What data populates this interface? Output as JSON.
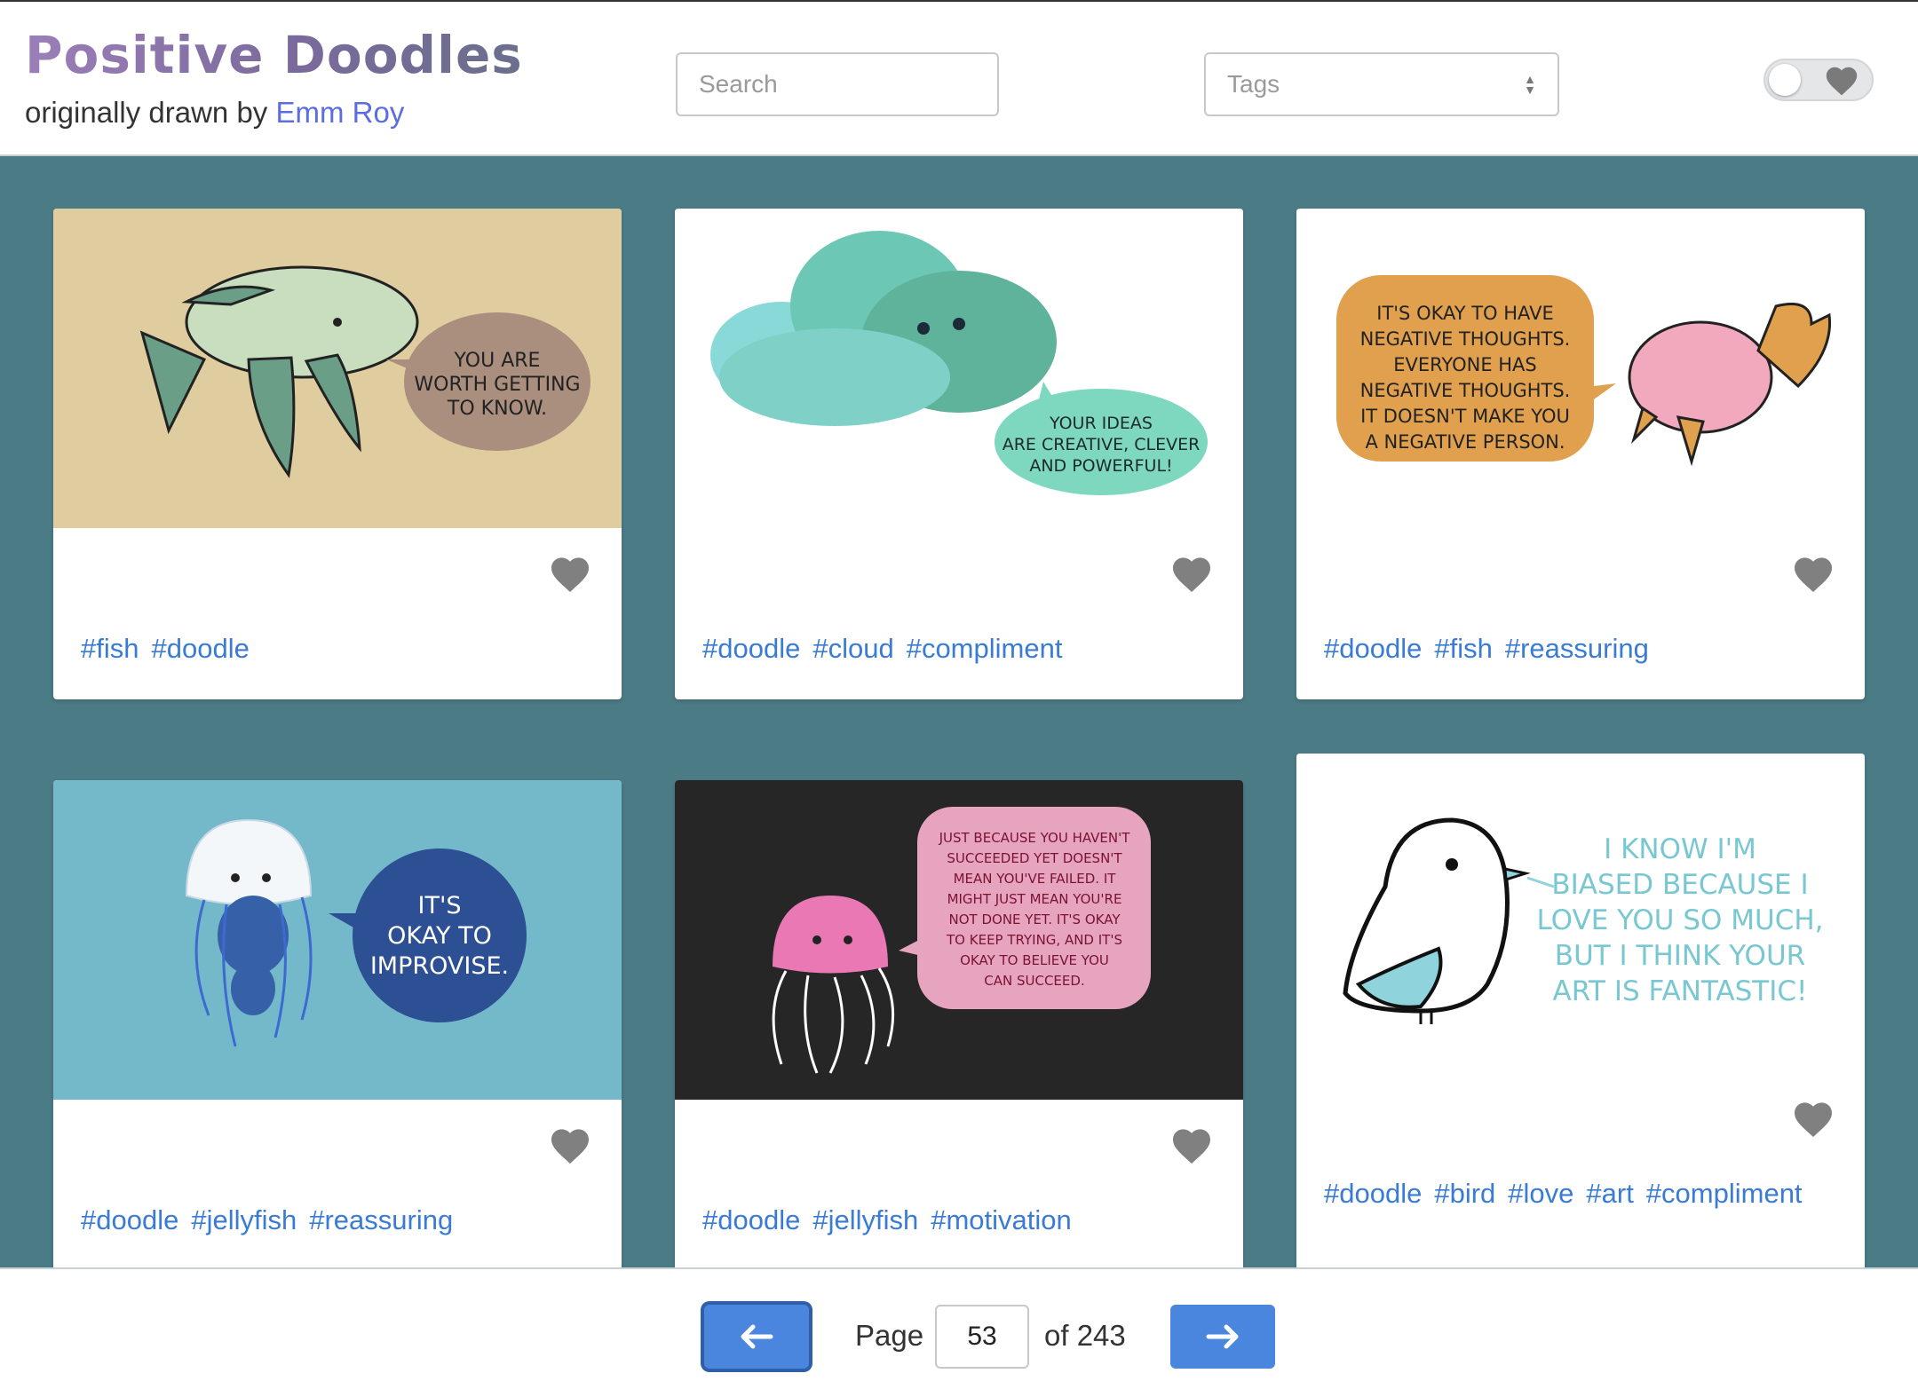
{
  "header": {
    "title": "Positive Doodles",
    "subtitle_prefix": "originally drawn by",
    "author": "Emm Roy",
    "search_placeholder": "Search",
    "tags_placeholder": "Tags",
    "favorites_toggle_icon": "heart-icon"
  },
  "cards": [
    {
      "image_text": [
        "YOU ARE",
        "WORTH GETTING",
        "TO KNOW."
      ],
      "tags": [
        "#fish",
        "#doodle"
      ]
    },
    {
      "image_text": [
        "YOUR IDEAS",
        "ARE CREATIVE, CLEVER",
        "AND POWERFUL!"
      ],
      "tags": [
        "#doodle",
        "#cloud",
        "#compliment"
      ]
    },
    {
      "image_text": [
        "IT'S OKAY TO HAVE",
        "NEGATIVE THOUGHTS.",
        "EVERYONE HAS",
        "NEGATIVE THOUGHTS.",
        "IT DOESN'T MAKE YOU",
        "A NEGATIVE PERSON."
      ],
      "tags": [
        "#doodle",
        "#fish",
        "#reassuring"
      ]
    },
    {
      "image_text": [
        "IT'S",
        "OKAY TO",
        "IMPROVISE."
      ],
      "tags": [
        "#doodle",
        "#jellyfish",
        "#reassuring"
      ]
    },
    {
      "image_text": [
        "JUST BECAUSE YOU HAVEN'T",
        "SUCCEEDED YET DOESN'T",
        "MEAN YOU'VE FAILED. IT",
        "MIGHT JUST MEAN YOU'RE",
        "NOT DONE YET. IT'S OKAY",
        "TO KEEP TRYING, AND IT'S",
        "OKAY TO BELIEVE YOU",
        "CAN SUCCEED."
      ],
      "tags": [
        "#doodle",
        "#jellyfish",
        "#motivation"
      ]
    },
    {
      "image_text": [
        "I KNOW I'M",
        "BIASED BECAUSE I",
        "LOVE YOU SO MUCH,",
        "BUT I THINK YOUR",
        "ART IS FANTASTIC!"
      ],
      "tags": [
        "#doodle",
        "#bird",
        "#love",
        "#art",
        "#compliment"
      ]
    }
  ],
  "pagination": {
    "page_label": "Page",
    "current_page": "53",
    "of_label": "of 243",
    "prev_icon": "arrow-left-icon",
    "next_icon": "arrow-right-icon"
  },
  "colors": {
    "background": "#4b7b85",
    "link": "#3a7bd5",
    "button": "#4a86de",
    "heart": "#808080"
  }
}
